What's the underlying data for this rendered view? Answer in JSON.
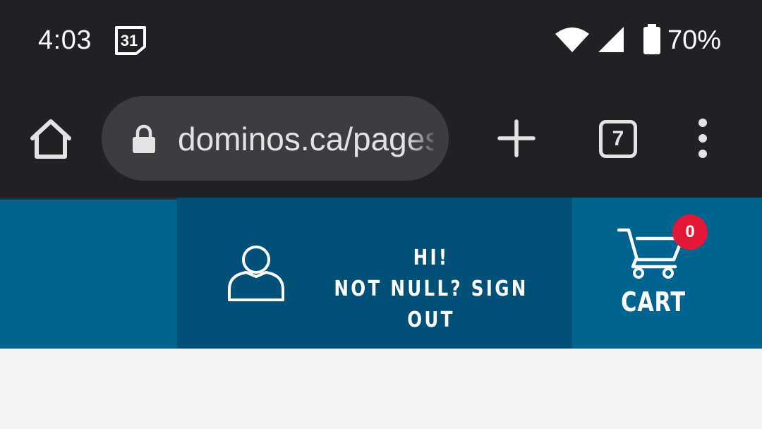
{
  "status_bar": {
    "time": "4:03",
    "calendar_day": "31",
    "battery_percent": "70%",
    "icons": [
      "calendar-icon",
      "wifi-icon",
      "signal-icon",
      "battery-icon"
    ]
  },
  "browser": {
    "url": "dominos.ca/pages/customer/",
    "tab_count": "7",
    "icons": [
      "home-icon",
      "lock-icon",
      "plus-icon",
      "more-vert-icon"
    ]
  },
  "header": {
    "greeting_line1": "HI!",
    "greeting_line2": "NOT NULL? SIGN OUT",
    "cart_label": "CART",
    "cart_count": "0",
    "icons": [
      "person-icon",
      "cart-icon"
    ]
  },
  "colors": {
    "chrome_dark": "#202124",
    "url_bar": "#3c3d41",
    "brand_blue": "#006491",
    "account_blue": "#005077",
    "badge_red": "#e31837",
    "page_bg": "#f4f4f3"
  }
}
